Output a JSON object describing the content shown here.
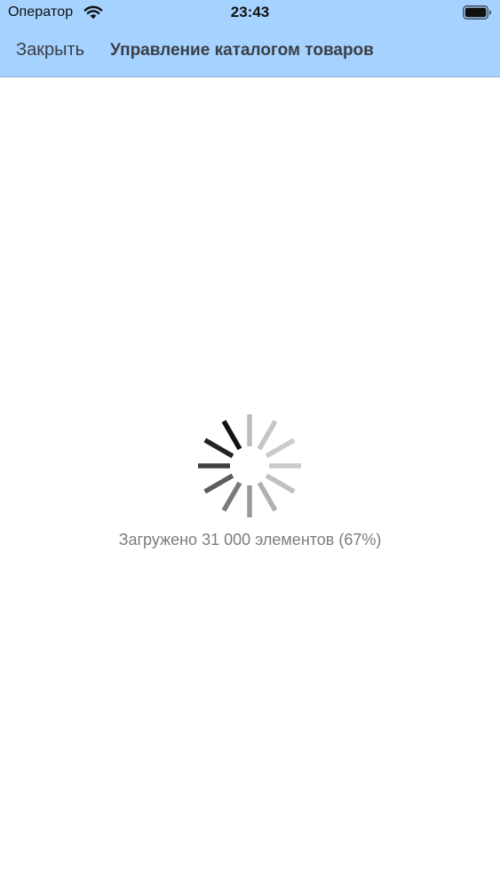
{
  "status_bar": {
    "carrier": "Оператор",
    "time": "23:43",
    "wifi_icon": "wifi-icon",
    "battery_icon": "battery-full-icon"
  },
  "nav_bar": {
    "close_label": "Закрыть",
    "title": "Управление каталогом товаров",
    "background_color": "#a5d2fe"
  },
  "loading": {
    "spinner_icon": "activity-indicator-icon",
    "status_text": "Загружено 31 000 элементов (67%)",
    "loaded_count": 31000,
    "progress_percent": 67
  }
}
